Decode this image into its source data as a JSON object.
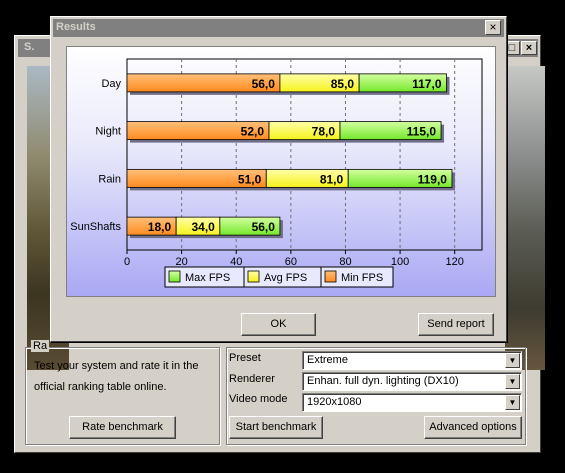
{
  "background_window": {
    "title_fragment": "S.",
    "rate_group_title_fragment": "Ra",
    "rate_description": "Test your system and rate it in the official ranking table online.",
    "rate_line1": "Test your system and rate it in the",
    "rate_line2": "official ranking table online.",
    "rate_button": "Rate benchmark",
    "settings": {
      "preset_label": "Preset",
      "preset_value": "Extreme",
      "renderer_label": "Renderer",
      "renderer_value": "Enhan. full dyn. lighting (DX10)",
      "video_mode_label": "Video mode",
      "video_mode_value": "1920x1080"
    },
    "start_button": "Start benchmark",
    "advanced_button": "Advanced options"
  },
  "dialog": {
    "title": "Results",
    "close_glyph": "×",
    "ok_button": "OK",
    "send_report_button": "Send report"
  },
  "chart_data": {
    "type": "bar",
    "orientation": "horizontal",
    "stacked": true,
    "categories": [
      "Day",
      "Night",
      "Rain",
      "SunShafts"
    ],
    "series": [
      {
        "name": "Min FPS",
        "values": [
          56.0,
          52.0,
          51.0,
          18.0
        ],
        "color": "#ff9a2e"
      },
      {
        "name": "Avg FPS",
        "values": [
          85.0,
          78.0,
          81.0,
          34.0
        ],
        "color": "#ffff3c"
      },
      {
        "name": "Max FPS",
        "values": [
          117.0,
          115.0,
          119.0,
          56.0
        ],
        "color": "#9cf54a"
      }
    ],
    "value_labels": [
      [
        "56,0",
        "85,0",
        "117,0"
      ],
      [
        "52,0",
        "78,0",
        "115,0"
      ],
      [
        "51,0",
        "81,0",
        "119,0"
      ],
      [
        "18,0",
        "34,0",
        "56,0"
      ]
    ],
    "xticks": [
      "0",
      "20",
      "40",
      "60",
      "80",
      "100",
      "120"
    ],
    "xlim": [
      0,
      130
    ],
    "grid": "vertical dashed",
    "legend_order": [
      "Max FPS",
      "Avg FPS",
      "Min FPS"
    ],
    "legend_placement": "bottom"
  }
}
